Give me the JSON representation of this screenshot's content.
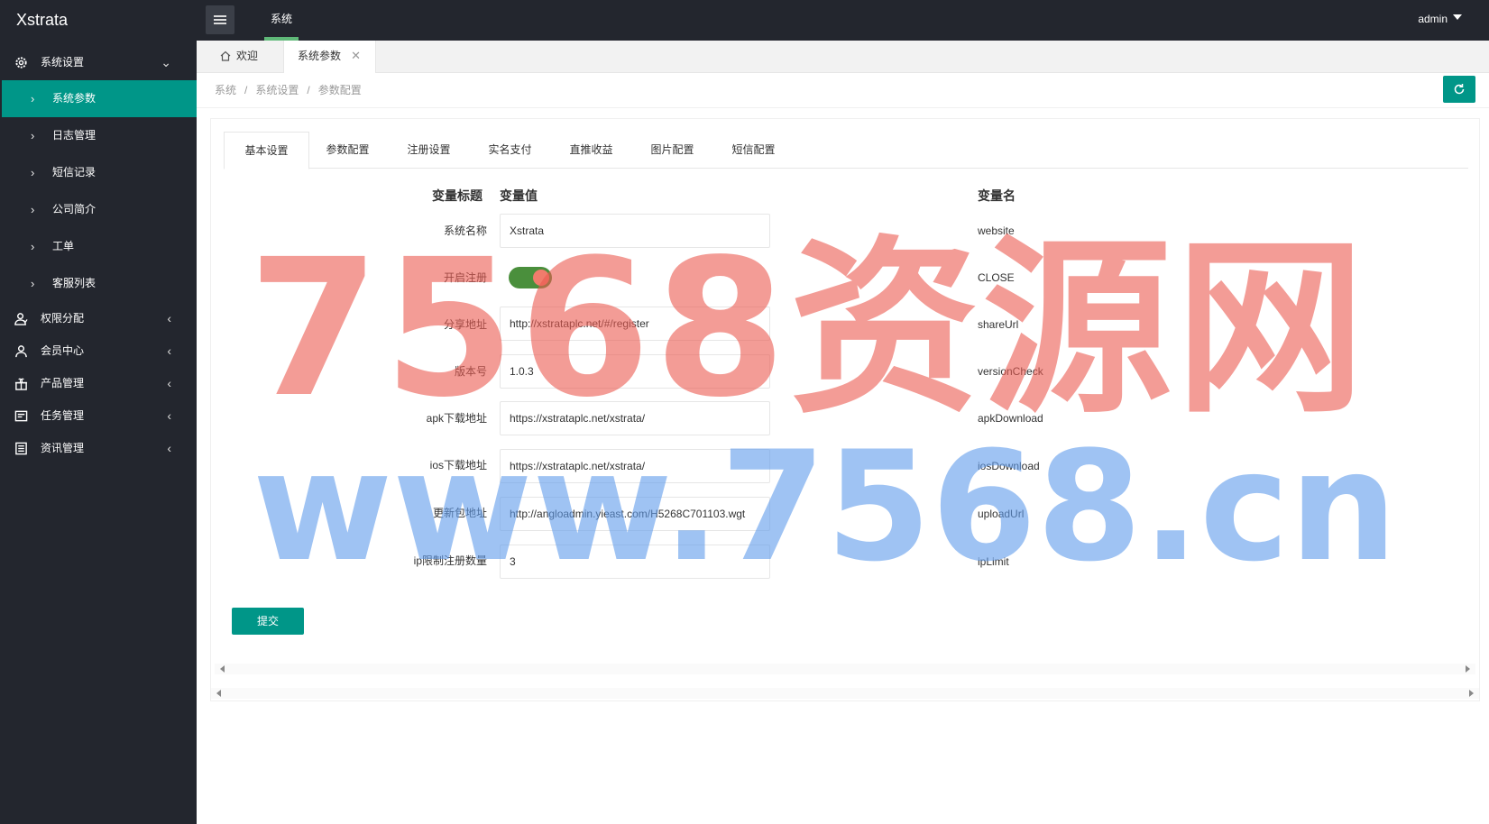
{
  "app": {
    "logo": "Xstrata",
    "top_nav": "系统",
    "user": "admin"
  },
  "sidebar": {
    "groups": [
      {
        "label": "系统设置",
        "icon": "gear-icon",
        "expanded": true
      },
      {
        "label": "权限分配",
        "icon": "user-group-icon"
      },
      {
        "label": "会员中心",
        "icon": "user-icon"
      },
      {
        "label": "产品管理",
        "icon": "product-icon"
      },
      {
        "label": "任务管理",
        "icon": "task-icon"
      },
      {
        "label": "资讯管理",
        "icon": "news-icon"
      }
    ],
    "children": [
      {
        "label": "系统参数",
        "active": true
      },
      {
        "label": "日志管理"
      },
      {
        "label": "短信记录"
      },
      {
        "label": "公司简介"
      },
      {
        "label": "工单"
      },
      {
        "label": "客服列表"
      }
    ]
  },
  "tabs": {
    "home": "欢迎",
    "active": "系统参数"
  },
  "breadcrumb": [
    "系统",
    "系统设置",
    "参数配置"
  ],
  "subtabs": [
    "基本设置",
    "参数配置",
    "注册设置",
    "实名支付",
    "直推收益",
    "图片配置",
    "短信配置"
  ],
  "form": {
    "headers": {
      "title": "变量标题",
      "value": "变量值",
      "name": "变量名"
    },
    "rows": [
      {
        "label": "系统名称",
        "value": "Xstrata",
        "var": "website"
      },
      {
        "label": "开启注册",
        "switch": true,
        "var": "CLOSE"
      },
      {
        "label": "分享地址",
        "value": "http://xstrataplc.net/#/register",
        "var": "shareUrl"
      },
      {
        "label": "版本号",
        "value": "1.0.3",
        "var": "versionCheck"
      },
      {
        "label": "apk下载地址",
        "value": "https://xstrataplc.net/xstrata/",
        "var": "apkDownload"
      },
      {
        "label": "ios下载地址",
        "value": "https://xstrataplc.net/xstrata/",
        "var": "iosDownload"
      },
      {
        "label": "更新包地址",
        "value": "http://angloadmin.yieast.com/H5268C701103.wgt",
        "var": "uploadUrl"
      },
      {
        "label": "ip限制注册数量",
        "value": "3",
        "var": "ipLimit"
      }
    ],
    "submit": "提交"
  },
  "watermark": {
    "line1": "7568资源网",
    "line2": "www.7568.cn"
  },
  "colors": {
    "accent": "#009688",
    "sidebar_bg": "#23262e",
    "nav_indicator": "#5fb878"
  }
}
